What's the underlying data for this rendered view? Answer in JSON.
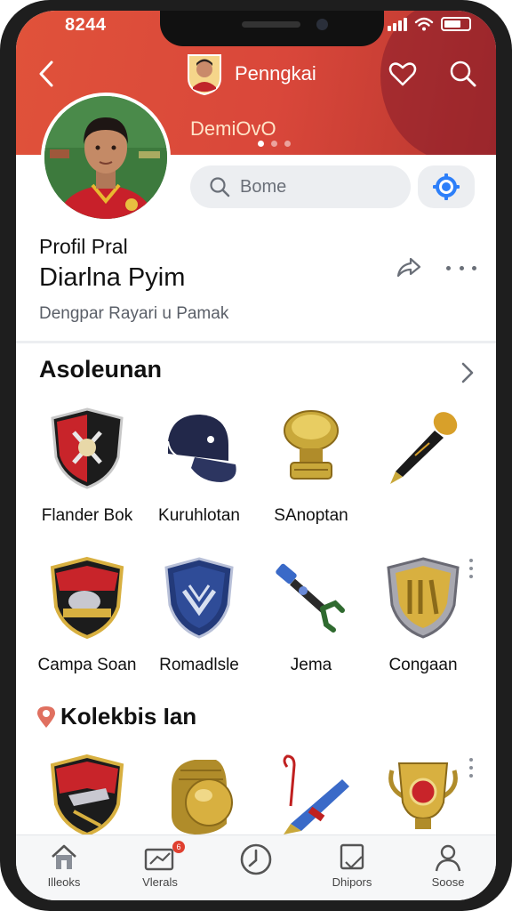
{
  "status": {
    "time": "8244"
  },
  "header": {
    "title": "Penngkai",
    "subtitle": "DemiOvO",
    "search_placeholder": "Bome"
  },
  "profile": {
    "label": "Profil Pral",
    "name": "Diarlna Pyim",
    "description": "Dengpar Rayari u Pamak"
  },
  "section1": {
    "title": "Asoleunan",
    "items": [
      {
        "label": "Flander Bok",
        "icon": "crest-shield-icon"
      },
      {
        "label": "Kuruhlotan",
        "icon": "cap-icon"
      },
      {
        "label": "SAnoptan",
        "icon": "trophy-cup-icon"
      },
      {
        "label": "",
        "icon": "microphone-icon"
      },
      {
        "label": "Campa Soan",
        "icon": "crest-shield-icon"
      },
      {
        "label": "Romadlsle",
        "icon": "blue-shield-icon"
      },
      {
        "label": "Jema",
        "icon": "tool-icon"
      },
      {
        "label": "Congaan",
        "icon": "gold-shield-icon"
      }
    ]
  },
  "section2": {
    "title": "Kolekbis Ian",
    "items": [
      {
        "icon": "crest-shield-icon"
      },
      {
        "icon": "gold-ring-icon"
      },
      {
        "icon": "pen-icon"
      },
      {
        "icon": "gold-cup-icon"
      }
    ]
  },
  "nav": {
    "items": [
      {
        "label": "Illeoks",
        "icon": "home-icon"
      },
      {
        "label": "Vlerals",
        "icon": "messages-icon",
        "badge": "6"
      },
      {
        "label": "",
        "icon": "clock-icon"
      },
      {
        "label": "Dhipors",
        "icon": "document-icon"
      },
      {
        "label": "Soose",
        "icon": "user-icon"
      }
    ]
  },
  "colors": {
    "header_red": "#d9473a",
    "accent_blue": "#2d7ff9",
    "badge_red": "#e04030"
  }
}
